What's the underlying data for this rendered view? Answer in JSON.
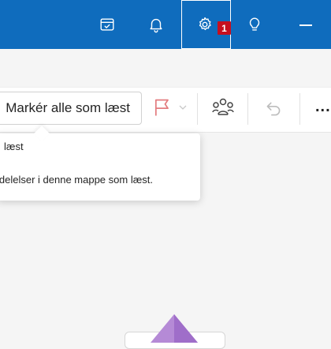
{
  "topbar": {
    "bg_color": "#0f6cbd",
    "buttons": [
      {
        "name": "my-day-icon"
      },
      {
        "name": "bell-icon"
      },
      {
        "name": "gear-icon"
      },
      {
        "name": "lightbulb-icon"
      },
      {
        "name": "minimize-icon"
      }
    ],
    "settings_badge": "1"
  },
  "toolbar": {
    "mark_all_read_label": "Markér alle som læst",
    "flag_icon": "flag-icon",
    "flag_color": "#e37d80",
    "people_icon": "people-group-icon",
    "undo_icon": "undo-icon",
    "more_label": "..."
  },
  "tooltip": {
    "title": "læst",
    "body": "ldelelser i denne mappe som læst."
  }
}
